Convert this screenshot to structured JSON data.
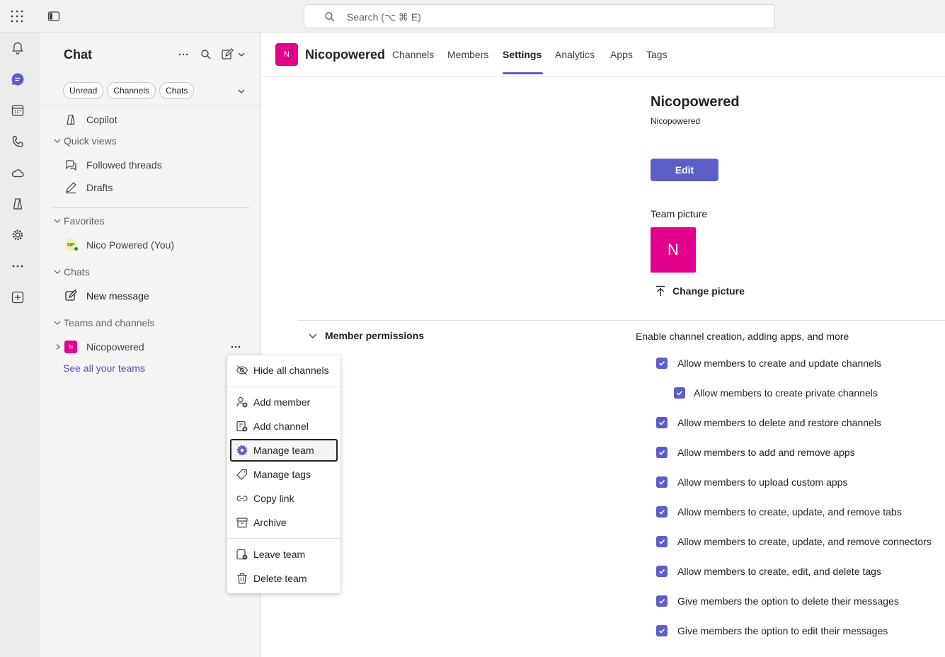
{
  "search": {
    "placeholder": "Search (⌥ ⌘ E)"
  },
  "chat": {
    "title": "Chat",
    "filters": [
      "Unread",
      "Channels",
      "Chats"
    ],
    "copilot": "Copilot",
    "quick_views_label": "Quick views",
    "quick_views": [
      "Followed threads",
      "Drafts"
    ],
    "favorites_label": "Favorites",
    "favorite_user": "Nico Powered (You)",
    "favorite_initials": "NP",
    "chats_label": "Chats",
    "new_message": "New message",
    "teams_label": "Teams and channels",
    "team_name": "Nicopowered",
    "team_initial": "N",
    "see_all": "See all your teams"
  },
  "menu": {
    "hide_all": "Hide all channels",
    "add_member": "Add member",
    "add_channel": "Add channel",
    "manage_team": "Manage team",
    "manage_tags": "Manage tags",
    "copy_link": "Copy link",
    "archive": "Archive",
    "leave_team": "Leave team",
    "delete_team": "Delete team"
  },
  "main": {
    "team_initial": "N",
    "team_name": "Nicopowered",
    "tabs": [
      "Channels",
      "Members",
      "Settings",
      "Analytics",
      "Apps",
      "Tags"
    ],
    "active_tab": "Settings",
    "settings_title": "Nicopowered",
    "settings_subtitle": "Nicopowered",
    "edit_label": "Edit",
    "team_picture_label": "Team picture",
    "picture_initial": "N",
    "change_picture": "Change picture",
    "permissions_title": "Member permissions",
    "permissions_desc": "Enable channel creation, adding apps, and more",
    "permissions": [
      "Allow members to create and update channels",
      "Allow members to create private channels",
      "Allow members to delete and restore channels",
      "Allow members to add and remove apps",
      "Allow members to upload custom apps",
      "Allow members to create, update, and remove tabs",
      "Allow members to create, update, and remove connectors",
      "Allow members to create, edit, and delete tags",
      "Give members the option to delete their messages",
      "Give members the option to edit their messages"
    ]
  },
  "colors": {
    "accent": "#5b5fc7",
    "team": "#e3008c",
    "link": "#4f52b2"
  }
}
